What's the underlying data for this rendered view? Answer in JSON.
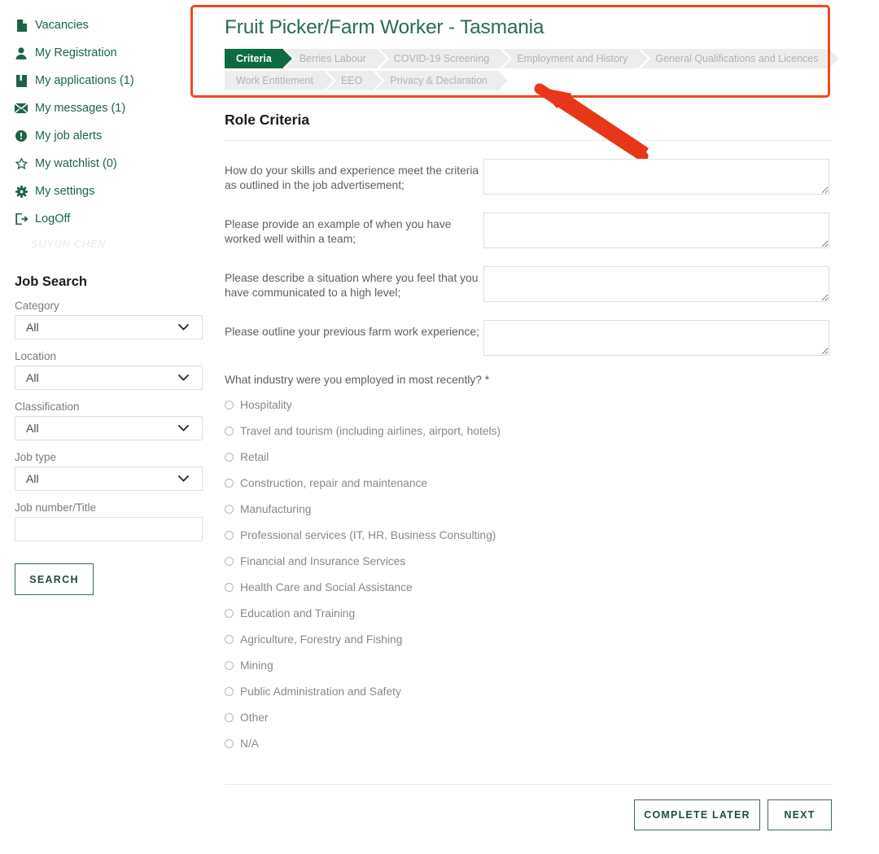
{
  "sidebar": {
    "nav_items": [
      {
        "label": "Vacancies",
        "icon": "file-icon"
      },
      {
        "label": "My Registration",
        "icon": "user-icon"
      },
      {
        "label": "My applications (1)",
        "icon": "book-icon"
      },
      {
        "label": "My messages (1)",
        "icon": "envelope-icon"
      },
      {
        "label": "My job alerts",
        "icon": "alert-circle-icon"
      },
      {
        "label": "My watchlist (0)",
        "icon": "star-icon"
      },
      {
        "label": "My settings",
        "icon": "gear-icon"
      },
      {
        "label": "LogOff",
        "icon": "logout-icon"
      }
    ],
    "username": "SUYUN CHEN",
    "job_search": {
      "title": "Job Search",
      "fields": [
        {
          "label": "Category",
          "value": "All",
          "type": "select"
        },
        {
          "label": "Location",
          "value": "All",
          "type": "select"
        },
        {
          "label": "Classification",
          "value": "All",
          "type": "select"
        },
        {
          "label": "Job type",
          "value": "All",
          "type": "select"
        }
      ],
      "job_number": {
        "label": "Job number/Title",
        "value": "",
        "placeholder": ""
      },
      "search_button": "SEARCH"
    }
  },
  "main": {
    "job_title": "Fruit Picker/Farm Worker - Tasmania",
    "crumbs_row1": [
      {
        "label": "Criteria",
        "active": true
      },
      {
        "label": "Berries Labour",
        "active": false
      },
      {
        "label": "COVID-19 Screening",
        "active": false
      },
      {
        "label": "Employment and History",
        "active": false
      },
      {
        "label": "General Qualifications and Licences",
        "active": false
      }
    ],
    "crumbs_row2": [
      {
        "label": "Work Entitlement",
        "active": false
      },
      {
        "label": "EEO",
        "active": false
      },
      {
        "label": "Privacy & Declaration",
        "active": false
      }
    ],
    "section_title": "Role Criteria",
    "questions": [
      {
        "label": "How do your skills and experience meet the criteria as outlined in the job advertisement;",
        "value": "",
        "placeholder": ""
      },
      {
        "label": "Please provide an example of when you have worked well within a team;",
        "value": "",
        "placeholder": ""
      },
      {
        "label": "Please describe a situation where you feel that you have communicated to a high level;",
        "value": "",
        "placeholder": ""
      },
      {
        "label": "Please outline your previous farm work experience;",
        "value": "",
        "placeholder": ""
      }
    ],
    "radio_question": "What industry were you employed in most recently? *",
    "radio_options": [
      "Hospitality",
      "Travel and tourism (including airlines, airport, hotels)",
      "Retail",
      "Construction, repair and maintenance",
      "Manufacturing",
      "Professional services (IT, HR, Business Consulting)",
      "Financial and Insurance Services",
      "Health Care and Social Assistance",
      "Education and Training",
      "Agriculture, Forestry and Fishing",
      "Mining",
      "Public Administration and Safety",
      "Other",
      "N/A"
    ],
    "footer": {
      "complete_later": "COMPLETE LATER",
      "next": "NEXT"
    }
  },
  "annotation": {
    "box_color": "#ea4a1f",
    "arrow_color": "#e8361a"
  },
  "colors": {
    "brand_green": "#1d6446",
    "title_green": "#2b6b52",
    "active_crumb": "#0d6b42",
    "crumb_bg": "#ededed",
    "crumb_text": "#b2b2b2"
  }
}
